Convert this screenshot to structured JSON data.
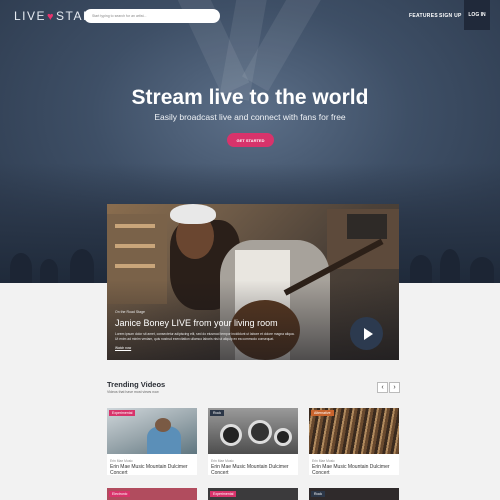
{
  "nav": {
    "logo_left": "LIVE",
    "logo_heart": "♥",
    "logo_right": "STAR",
    "search_placeholder": "Start typing to search for an artist...",
    "features": "FEATURES",
    "signup": "SIGN UP",
    "login": "LOG IN"
  },
  "hero": {
    "headline": "Stream live to the world",
    "subline": "Easily broadcast live and connect with fans for free",
    "cta": "GET STARTED"
  },
  "featured": {
    "category": "On the Road Stage",
    "title": "Janice Boney LIVE from your living room",
    "description": "Lorem ipsum dolor sit amet, consectetur adipiscing elit, sed do eiusmod tempor incididunt ut labore et dolore magna aliqua. Ut enim ad minim veniam, quis nostrud exercitation ullamco laboris nisi ut aliquip ex ea commodo consequat.",
    "more": "Watch now"
  },
  "trending": {
    "title": "Trending Videos",
    "subtitle": "Videos that have most views now",
    "prev": "‹",
    "next": "›",
    "cards": [
      {
        "badge": "Experimental",
        "artist": "Erin Mae Music",
        "title": "Erin Mae Music Mountain Dulcimer Concert"
      },
      {
        "badge": "Rock",
        "artist": "Erin Mae Music",
        "title": "Erin Mae Music Mountain Dulcimer Concert"
      },
      {
        "badge": "Alternative",
        "artist": "Erin Mae Music",
        "title": "Erin Mae Music Mountain Dulcimer Concert"
      }
    ],
    "row2": [
      {
        "badge": "Electronic"
      },
      {
        "badge": "Experimental"
      },
      {
        "badge": "Rock"
      }
    ]
  },
  "colors": {
    "accent": "#d8336b",
    "hero_bg": "#3e4f66",
    "badge_experimental": "#d8336b",
    "badge_rock": "#2b3647",
    "badge_alternative": "#c9642d"
  }
}
